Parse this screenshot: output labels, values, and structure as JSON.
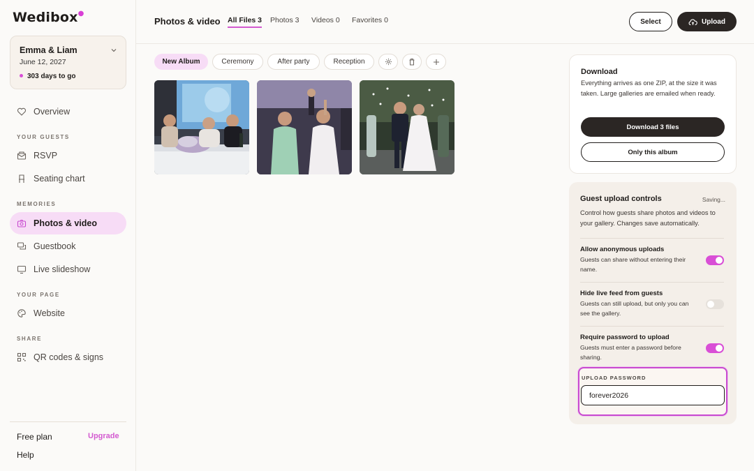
{
  "brand": {
    "name": "Wedibox",
    "accent": "#d94fd6"
  },
  "event": {
    "name": "Emma & Liam",
    "date": "June 12, 2027",
    "countdown": "303 days to go"
  },
  "nav": {
    "overview": "Overview",
    "section_guests": "YOUR GUESTS",
    "rsvp": "RSVP",
    "seating": "Seating chart",
    "section_memories": "MEMORIES",
    "photos": "Photos & video",
    "guestbook": "Guestbook",
    "slideshow": "Live slideshow",
    "section_page": "YOUR PAGE",
    "website": "Website",
    "section_share": "SHARE",
    "qr": "QR codes & signs"
  },
  "footer": {
    "plan": "Free plan",
    "upgrade": "Upgrade",
    "help": "Help"
  },
  "header": {
    "title": "Photos & video",
    "tabs": [
      "All Files 3",
      "Photos 3",
      "Videos 0",
      "Favorites 0"
    ],
    "select_label": "Select",
    "upload_label": "Upload"
  },
  "albums": [
    "New Album",
    "Ceremony",
    "After party",
    "Reception"
  ],
  "download": {
    "title": "Download",
    "description": "Everything arrives as one ZIP, at the size it was taken. Large galleries are emailed when ready.",
    "all_label": "Download 3 files",
    "album_label": "Only this album"
  },
  "guest_controls": {
    "title": "Guest upload controls",
    "status": "Saving...",
    "description": "Control how guests share photos and videos to your gallery. Changes save automatically.",
    "options": [
      {
        "title": "Allow anonymous uploads",
        "desc": "Guests can share without entering their name.",
        "on": true
      },
      {
        "title": "Hide live feed from guests",
        "desc": "Guests can still upload, but only you can see the gallery.",
        "on": false
      },
      {
        "title": "Require password to upload",
        "desc": "Guests must enter a password before sharing.",
        "on": true
      }
    ],
    "password_label": "UPLOAD PASSWORD",
    "password_value": "forever2026"
  }
}
